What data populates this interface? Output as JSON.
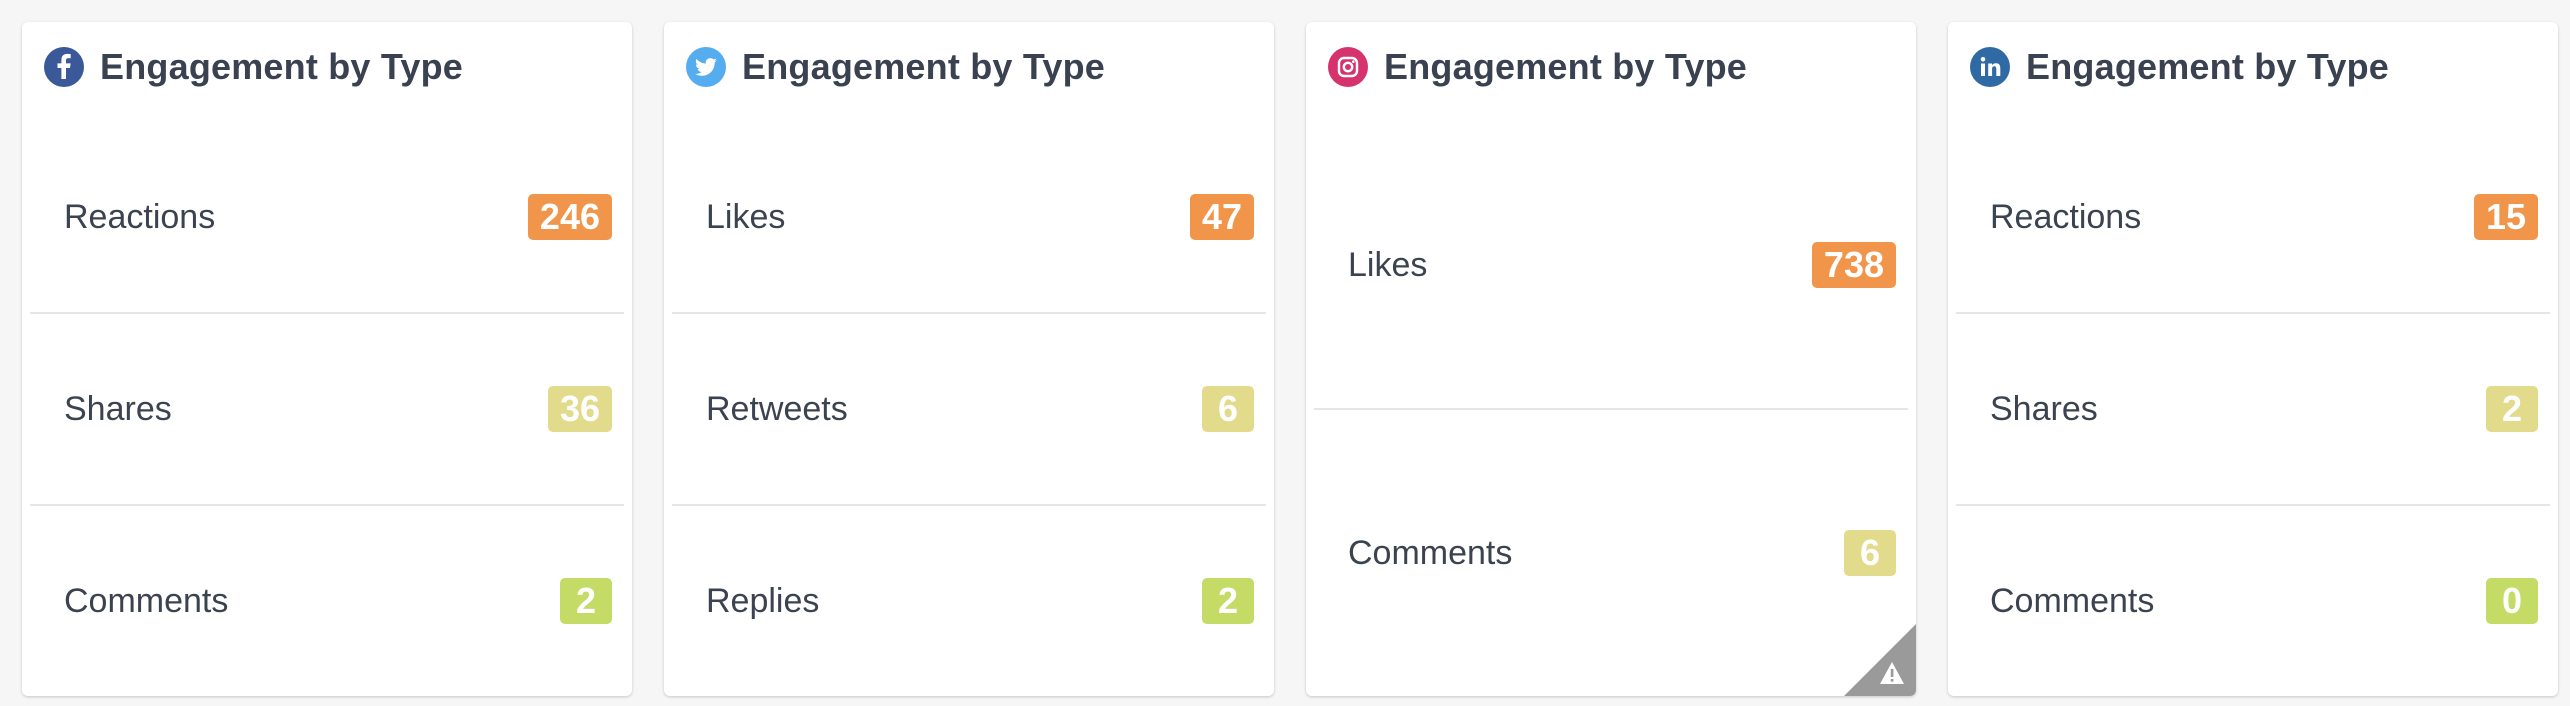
{
  "colors": {
    "badge_orange": "#f0954a",
    "badge_khaki": "#e3db8c",
    "badge_green": "#c4dc66",
    "facebook": "#3b5998",
    "twitter": "#55acee",
    "instagram": "#d6336c",
    "linkedin": "#2f6aa5",
    "warning_corner": "#9a9a9a"
  },
  "cards": [
    {
      "network": "facebook",
      "icon": "facebook-icon",
      "title": "Engagement by Type",
      "rows": [
        {
          "label": "Reactions",
          "value": "246",
          "color": "#f0954a"
        },
        {
          "label": "Shares",
          "value": "36",
          "color": "#e3db8c"
        },
        {
          "label": "Comments",
          "value": "2",
          "color": "#c4dc66"
        }
      ]
    },
    {
      "network": "twitter",
      "icon": "twitter-icon",
      "title": "Engagement by Type",
      "rows": [
        {
          "label": "Likes",
          "value": "47",
          "color": "#f0954a"
        },
        {
          "label": "Retweets",
          "value": "6",
          "color": "#e3db8c"
        },
        {
          "label": "Replies",
          "value": "2",
          "color": "#c4dc66"
        }
      ]
    },
    {
      "network": "instagram",
      "icon": "instagram-icon",
      "title": "Engagement by Type",
      "rows": [
        {
          "label": "Likes",
          "value": "738",
          "color": "#f0954a"
        },
        {
          "label": "Comments",
          "value": "6",
          "color": "#e3db8c"
        }
      ],
      "warning_icon": "warning-icon"
    },
    {
      "network": "linkedin",
      "icon": "linkedin-icon",
      "title": "Engagement by Type",
      "rows": [
        {
          "label": "Reactions",
          "value": "15",
          "color": "#f0954a"
        },
        {
          "label": "Shares",
          "value": "2",
          "color": "#e3db8c"
        },
        {
          "label": "Comments",
          "value": "0",
          "color": "#c4dc66"
        }
      ]
    }
  ]
}
